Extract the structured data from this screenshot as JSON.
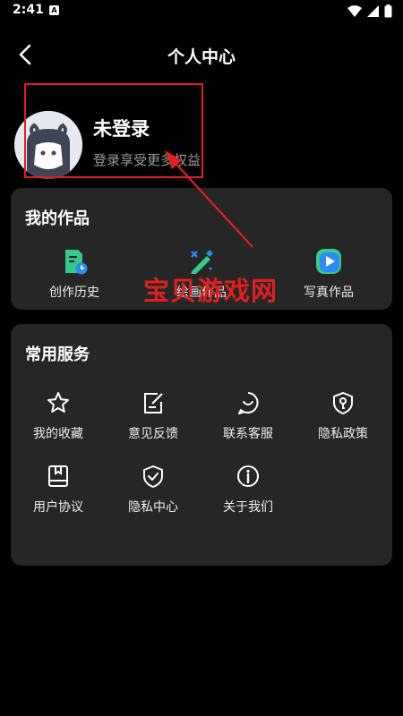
{
  "status_bar": {
    "time": "2:41",
    "notification_badge": "A"
  },
  "nav": {
    "title": "个人中心"
  },
  "profile": {
    "name": "未登录",
    "subtitle": "登录享受更多权益"
  },
  "works": {
    "title": "我的作品",
    "items": [
      {
        "label": "创作历史",
        "icon": "history-doc-icon"
      },
      {
        "label": "绘画作品",
        "icon": "paint-brush-icon"
      },
      {
        "label": "写真作品",
        "icon": "play-icon"
      }
    ]
  },
  "services": {
    "title": "常用服务",
    "items": [
      {
        "label": "我的收藏",
        "icon": "star-icon"
      },
      {
        "label": "意见反馈",
        "icon": "feedback-icon"
      },
      {
        "label": "联系客服",
        "icon": "customer-service-icon"
      },
      {
        "label": "隐私政策",
        "icon": "privacy-policy-icon"
      },
      {
        "label": "用户协议",
        "icon": "user-agreement-icon"
      },
      {
        "label": "隐私中心",
        "icon": "shield-icon"
      },
      {
        "label": "关于我们",
        "icon": "info-icon"
      }
    ]
  },
  "watermark": {
    "text": "宝贝游戏网"
  },
  "colors": {
    "background": "#000000",
    "card": "#262626",
    "annotation": "#e02020",
    "accent_green": "#35c98a",
    "accent_blue": "#2b8af5"
  }
}
